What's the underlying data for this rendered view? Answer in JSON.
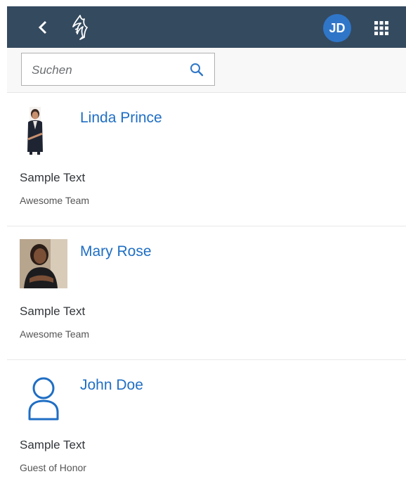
{
  "shellbar": {
    "back_icon": "chevron-left-icon",
    "logo_icon": "bird-logo-icon",
    "avatar_initials": "JD",
    "menu_icon": "grid-menu-icon",
    "bar_color": "#344a5f",
    "avatar_color": "#2f76c8"
  },
  "search": {
    "placeholder": "Suchen",
    "icon": "search-icon"
  },
  "people": [
    {
      "name": "Linda Prince",
      "text": "Sample Text",
      "team": "Awesome Team",
      "photo": "linda-photo"
    },
    {
      "name": "Mary Rose",
      "text": "Sample Text",
      "team": "Awesome Team",
      "photo": "mary-photo"
    },
    {
      "name": "John Doe",
      "text": "Sample Text",
      "team": "Guest of Honor",
      "photo": "person-placeholder-icon"
    }
  ],
  "colors": {
    "link": "#1f6ec4",
    "text": "#32363a"
  }
}
